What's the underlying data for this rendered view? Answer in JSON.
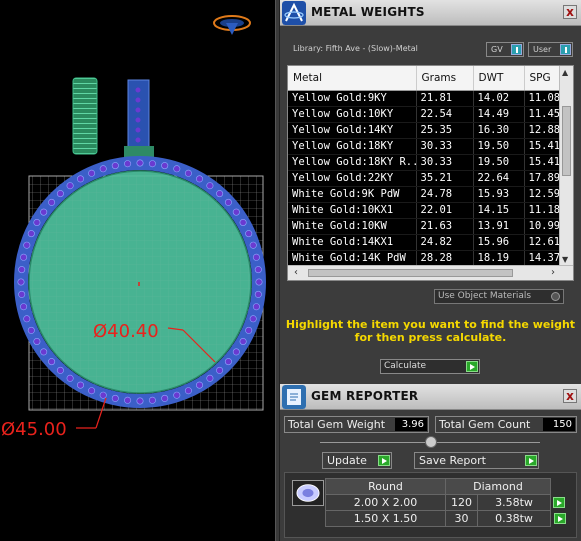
{
  "viewport": {
    "dim_inner": "Ø40.40",
    "dim_outer": "Ø45.00",
    "colors": {
      "ring": "#3b5fc8",
      "gem": "#6a3ad0",
      "face": "#4ec29e",
      "dim": "#e8221c",
      "grid": "#9a9a9a"
    }
  },
  "metal_weights": {
    "title": "METAL WEIGHTS",
    "close": "x",
    "library": "Library: Fifth Ave - (Slow)-Metal",
    "gv_label": "GV",
    "user_label": "User",
    "columns": [
      "Metal",
      "Grams",
      "DWT",
      "SPG"
    ],
    "rows": [
      [
        "Yellow Gold:9KY",
        "21.81",
        "14.02",
        "11.08"
      ],
      [
        "Yellow Gold:10KY",
        "22.54",
        "14.49",
        "11.45"
      ],
      [
        "Yellow Gold:14KY",
        "25.35",
        "16.30",
        "12.88"
      ],
      [
        "Yellow Gold:18KY",
        "30.33",
        "19.50",
        "15.41"
      ],
      [
        "Yellow Gold:18KY R...",
        "30.33",
        "19.50",
        "15.41"
      ],
      [
        "Yellow Gold:22KY",
        "35.21",
        "22.64",
        "17.89"
      ],
      [
        "White Gold:9K PdW",
        "24.78",
        "15.93",
        "12.59"
      ],
      [
        "White Gold:10KX1",
        "22.01",
        "14.15",
        "11.18"
      ],
      [
        "White Gold:10KW",
        "21.63",
        "13.91",
        "10.99"
      ],
      [
        "White Gold:14KX1",
        "24.82",
        "15.96",
        "12.61"
      ],
      [
        "White Gold:14K PdW",
        "28.28",
        "18.19",
        "14.37"
      ]
    ],
    "use_object_materials": "Use Object Materials",
    "hint_line1": "Highlight the item you want to find the weight",
    "hint_line2": "for then press calculate.",
    "calculate_label": "Calculate"
  },
  "gem_reporter": {
    "title": "GEM REPORTER",
    "close": "x",
    "total_weight_label": "Total Gem Weight",
    "total_weight_value": "3.96",
    "total_count_label": "Total Gem Count",
    "total_count_value": "150",
    "update_label": "Update",
    "save_report_label": "Save Report",
    "shape_header": "Round",
    "type_header": "Diamond",
    "rows": [
      {
        "size": "2.00 X 2.00",
        "count": "120",
        "weight": "3.58tw"
      },
      {
        "size": "1.50 X 1.50",
        "count": "30",
        "weight": "0.38tw"
      }
    ]
  }
}
